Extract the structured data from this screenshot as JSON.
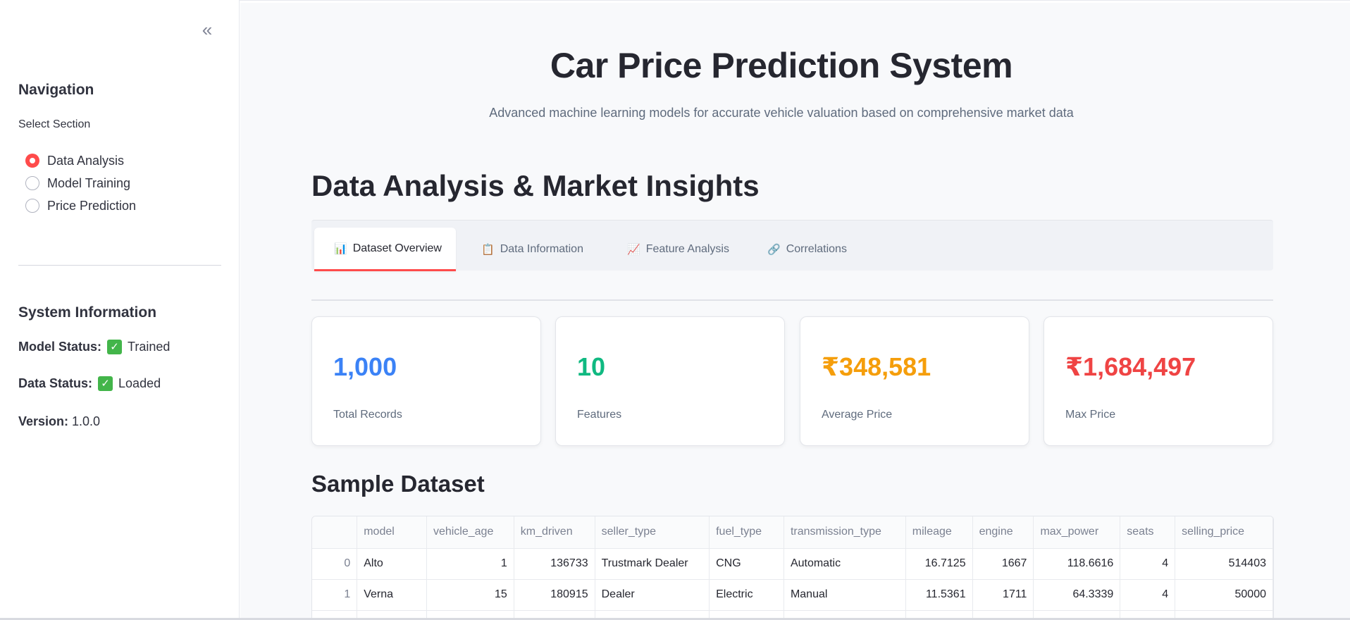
{
  "sidebar": {
    "collapse_glyph": "«",
    "nav_heading": "Navigation",
    "select_label": "Select Section",
    "options": [
      {
        "label": "Data Analysis",
        "selected": true
      },
      {
        "label": "Model Training",
        "selected": false
      },
      {
        "label": "Price Prediction",
        "selected": false
      }
    ],
    "system_heading": "System Information",
    "model_status_label": "Model Status:",
    "model_status_value": "Trained",
    "data_status_label": "Data Status:",
    "data_status_value": "Loaded",
    "version_label": "Version:",
    "version_value": "1.0.0",
    "check_icon": "check-mark-button-icon",
    "accent_color": "#ff4b4b"
  },
  "header": {
    "title": "Car Price Prediction System",
    "subtitle": "Advanced machine learning models for accurate vehicle valuation based on comprehensive market data"
  },
  "section": {
    "title": "Data Analysis & Market Insights"
  },
  "tabs": [
    {
      "label": "Dataset Overview",
      "icon": "bar-chart-icon",
      "glyph": "📊",
      "active": true
    },
    {
      "label": "Data Information",
      "icon": "clipboard-icon",
      "glyph": "📋",
      "active": false
    },
    {
      "label": "Feature Analysis",
      "icon": "chart-increasing-icon",
      "glyph": "📈",
      "active": false
    },
    {
      "label": "Correlations",
      "icon": "link-icon",
      "glyph": "🔗",
      "active": false
    }
  ],
  "metrics": [
    {
      "value": "1,000",
      "label": "Total Records",
      "color": "#3b82f6"
    },
    {
      "value": "10",
      "label": "Features",
      "color": "#10b981"
    },
    {
      "value": "₹348,581",
      "label": "Average Price",
      "color": "#f59e0b"
    },
    {
      "value": "₹1,684,497",
      "label": "Max Price",
      "color": "#ef4444"
    }
  ],
  "sample": {
    "title": "Sample Dataset",
    "columns": [
      "",
      "model",
      "vehicle_age",
      "km_driven",
      "seller_type",
      "fuel_type",
      "transmission_type",
      "mileage",
      "engine",
      "max_power",
      "seats",
      "selling_price"
    ],
    "rows": [
      [
        "0",
        "Alto",
        "1",
        "136733",
        "Trustmark Dealer",
        "CNG",
        "Automatic",
        "16.7125",
        "1667",
        "118.6616",
        "4",
        "514403"
      ],
      [
        "1",
        "Verna",
        "15",
        "180915",
        "Dealer",
        "Electric",
        "Manual",
        "11.5361",
        "1711",
        "64.3339",
        "4",
        "50000"
      ],
      [
        "",
        "",
        "",
        "",
        "",
        "",
        "",
        "",
        "",
        "",
        "",
        ""
      ]
    ]
  }
}
